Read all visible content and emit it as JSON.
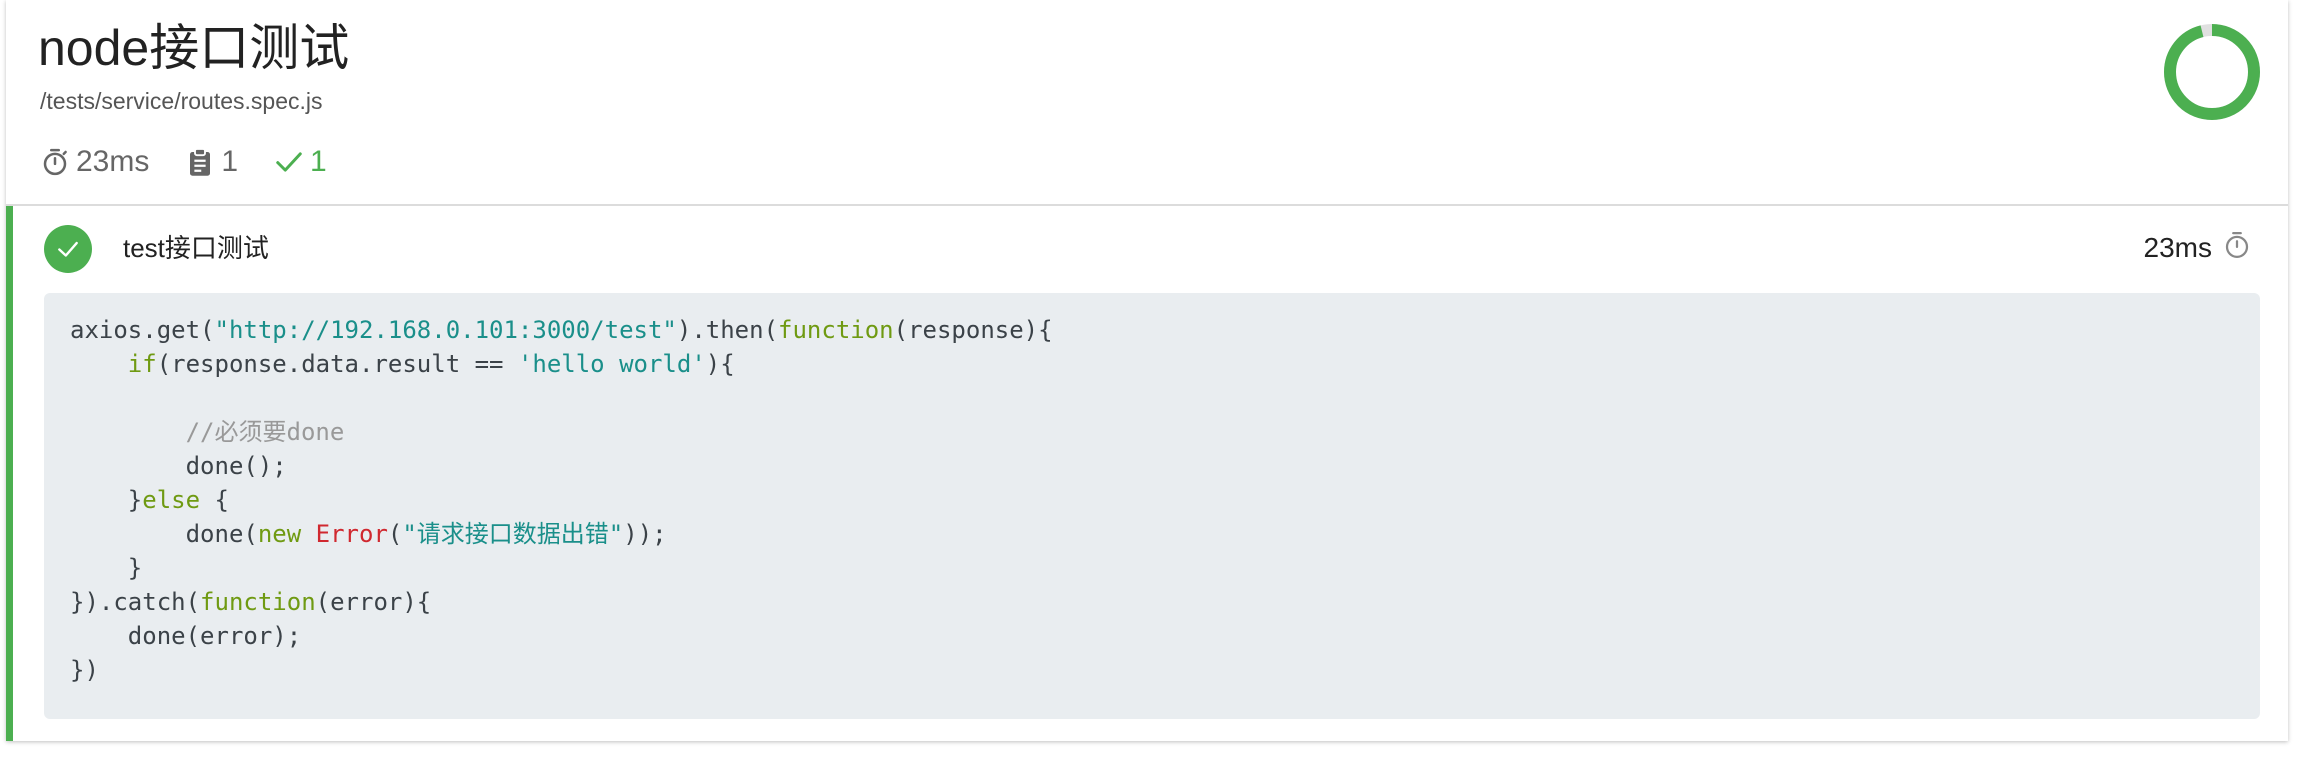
{
  "suite": {
    "title": "node接口测试",
    "file": "/tests/service/routes.spec.js",
    "stats": {
      "duration": "23ms",
      "tests": "1",
      "passes": "1"
    },
    "pass_fraction": 1.0,
    "icons": {
      "duration": "stopwatch-icon",
      "tests": "clipboard-icon",
      "passes": "check-icon"
    }
  },
  "test": {
    "status": "passed",
    "title": "test接口测试",
    "duration": "23ms",
    "icons": {
      "status": "check-circle-icon",
      "duration": "stopwatch-icon"
    },
    "code_lines": [
      [
        {
          "t": "axios.get("
        },
        {
          "t": "\"http://192.168.0.101:3000/test\"",
          "c": "str"
        },
        {
          "t": ").then("
        },
        {
          "t": "function",
          "c": "kw"
        },
        {
          "t": "(response){"
        }
      ],
      [
        {
          "t": "    "
        },
        {
          "t": "if",
          "c": "kw"
        },
        {
          "t": "(response.data.result == "
        },
        {
          "t": "'hello world'",
          "c": "str"
        },
        {
          "t": "){"
        }
      ],
      [
        {
          "t": ""
        }
      ],
      [
        {
          "t": "        "
        },
        {
          "t": "//必须要done",
          "c": "cm"
        }
      ],
      [
        {
          "t": "        done();"
        }
      ],
      [
        {
          "t": "    }"
        },
        {
          "t": "else",
          "c": "kw"
        },
        {
          "t": " {"
        }
      ],
      [
        {
          "t": "        done("
        },
        {
          "t": "new",
          "c": "kw"
        },
        {
          "t": " "
        },
        {
          "t": "Error",
          "c": "cls"
        },
        {
          "t": "("
        },
        {
          "t": "\"请求接口数据出错\"",
          "c": "str"
        },
        {
          "t": "));"
        }
      ],
      [
        {
          "t": "    }"
        }
      ],
      [
        {
          "t": "}).catch("
        },
        {
          "t": "function",
          "c": "kw"
        },
        {
          "t": "(error){"
        }
      ],
      [
        {
          "t": "    done(error);"
        }
      ],
      [
        {
          "t": "})"
        }
      ]
    ]
  },
  "colors": {
    "pass": "#4caf50",
    "code_bg": "#e9edf0",
    "string": "#1a8f8a",
    "keyword": "#6f9a12",
    "comment": "#999999",
    "class": "#d0282f"
  }
}
